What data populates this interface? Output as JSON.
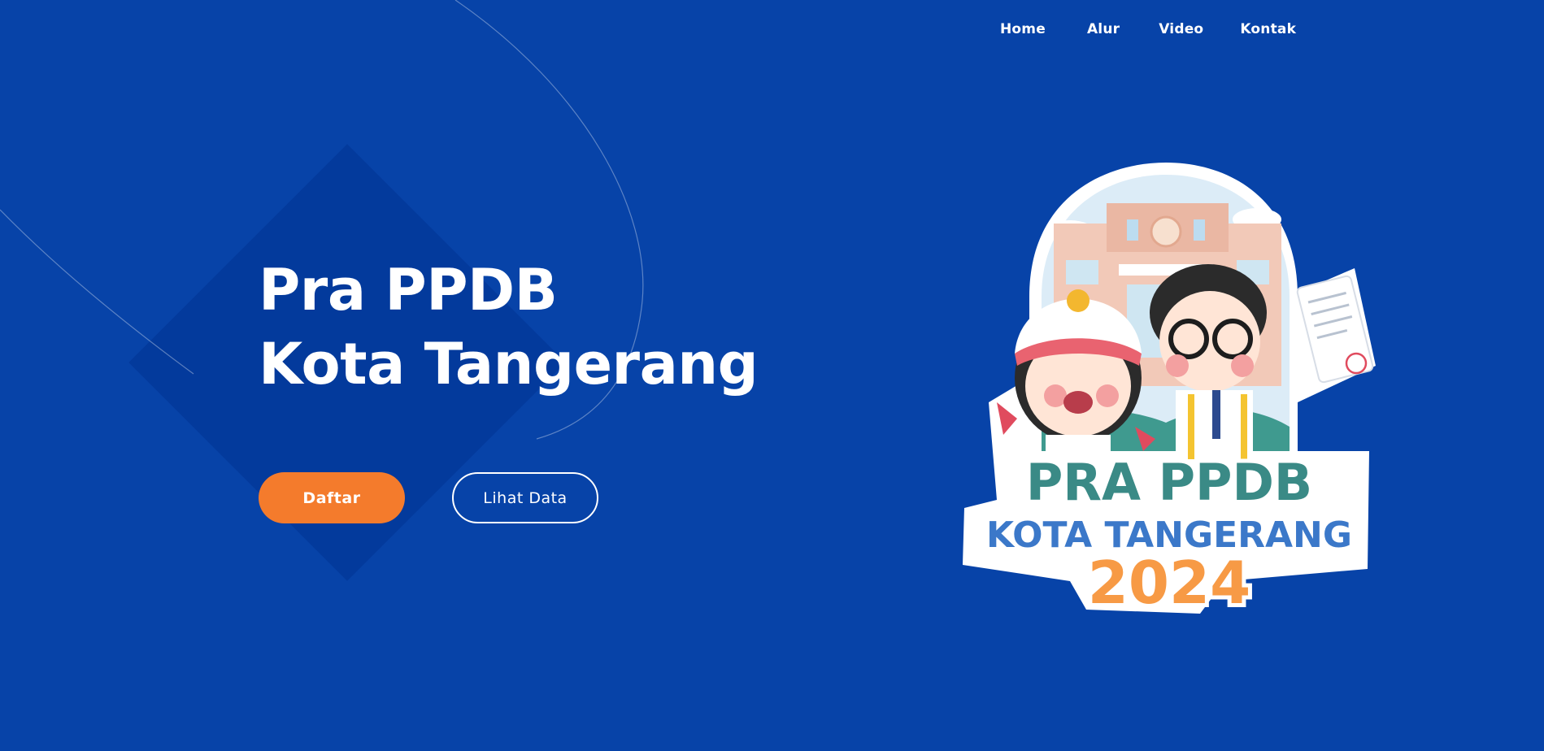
{
  "nav": {
    "items": [
      {
        "label": "Home"
      },
      {
        "label": "Alur"
      },
      {
        "label": "Video"
      },
      {
        "label": "Kontak"
      }
    ]
  },
  "hero": {
    "title_line1": "Pra PPDB",
    "title_line2": "Kota Tangerang",
    "primary_button": "Daftar",
    "secondary_button": "Lihat Data"
  },
  "logo": {
    "line1": "PRA PPDB",
    "line2": "KOTA TANGERANG",
    "line3": "2024"
  },
  "colors": {
    "background": "#0743a8",
    "accent": "#f47b2c",
    "text": "#ffffff"
  }
}
